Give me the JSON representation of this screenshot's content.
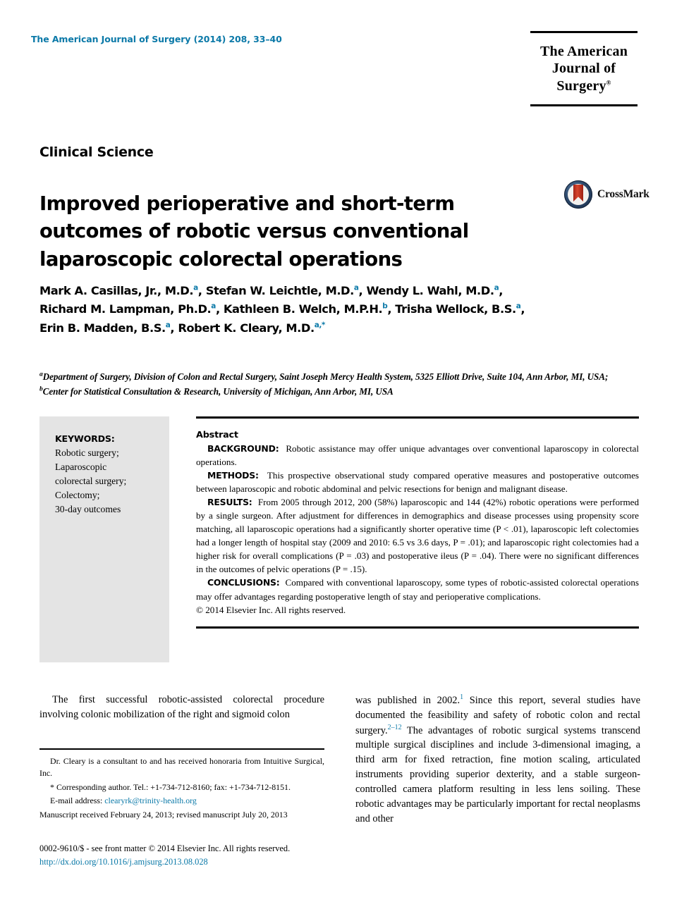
{
  "header": {
    "running_head": "The American Journal of Surgery (2014) 208, 33–40",
    "journal_logo_line1": "The American",
    "journal_logo_line2": "Journal of Surgery",
    "journal_logo_mark": "®"
  },
  "section_label": "Clinical Science",
  "title": "Improved perioperative and short-term outcomes of robotic versus conventional laparoscopic colorectal operations",
  "crossmark": {
    "label": "CrossMark",
    "badge_outer_color": "#2b4668",
    "badge_ribbon_color": "#c0351f"
  },
  "authors": {
    "line1_a": "Mark A. Casillas, Jr., M.D.",
    "line1_a_sup": "a",
    "line1_b": ", Stefan W. Leichtle, M.D.",
    "line1_b_sup": "a",
    "line1_c": ", Wendy L. Wahl, M.D.",
    "line1_c_sup": "a",
    "line1_d": ",",
    "line2_a": "Richard M. Lampman, Ph.D.",
    "line2_a_sup": "a",
    "line2_b": ", Kathleen B. Welch, M.P.H.",
    "line2_b_sup": "b",
    "line2_c": ", Trisha Wellock, B.S.",
    "line2_c_sup": "a",
    "line2_d": ",",
    "line3_a": "Erin B. Madden, B.S.",
    "line3_a_sup": "a",
    "line3_b": ", Robert K. Cleary, M.D.",
    "line3_b_sup": "a,*",
    "accent_color": "#0b79a8"
  },
  "affiliations": {
    "sup_a": "a",
    "text_a": "Department of Surgery, Division of Colon and Rectal Surgery, Saint Joseph Mercy Health System, 5325 Elliott Drive, Suite 104, Ann Arbor, MI, USA; ",
    "sup_b": "b",
    "text_b": "Center for Statistical Consultation & Research, University of Michigan, Ann Arbor, MI, USA"
  },
  "keywords": {
    "heading": "KEYWORDS:",
    "items": [
      "Robotic surgery;",
      "Laparoscopic",
      "colorectal surgery;",
      "Colectomy;",
      "30-day outcomes"
    ],
    "background_color": "#e4e4e4"
  },
  "abstract": {
    "heading": "Abstract",
    "background_label": "BACKGROUND:",
    "background_text": "Robotic assistance may offer unique advantages over conventional laparoscopy in colorectal operations.",
    "methods_label": "METHODS:",
    "methods_text": "This prospective observational study compared operative measures and postoperative outcomes between laparoscopic and robotic abdominal and pelvic resections for benign and malignant disease.",
    "results_label": "RESULTS:",
    "results_text": "From 2005 through 2012, 200 (58%) laparoscopic and 144 (42%) robotic operations were performed by a single surgeon. After adjustment for differences in demographics and disease processes using propensity score matching, all laparoscopic operations had a significantly shorter operative time (P < .01), laparoscopic left colectomies had a longer length of hospital stay (2009 and 2010: 6.5 vs 3.6 days, P = .01); and laparoscopic right colectomies had a higher risk for overall complications (P = .03) and postoperative ileus (P = .04). There were no significant differences in the outcomes of pelvic operations (P = .15).",
    "conclusions_label": "CONCLUSIONS:",
    "conclusions_text": "Compared with conventional laparoscopy, some types of robotic-assisted colorectal operations may offer advantages regarding postoperative length of stay and perioperative complications.",
    "copyright": "© 2014 Elsevier Inc. All rights reserved."
  },
  "body": {
    "left_para": "The first successful robotic-assisted colorectal procedure involving colonic mobilization of the right and sigmoid colon",
    "right_para_1": "was published in 2002.",
    "right_sup_1": "1",
    "right_para_2": " Since this report, several studies have documented the feasibility and safety of robotic colon and rectal surgery.",
    "right_sup_2": "2–12",
    "right_para_3": " The advantages of robotic surgical systems transcend multiple surgical disciplines and include 3-dimensional imaging, a third arm for fixed retraction, fine motion scaling, articulated instruments providing superior dexterity, and a stable surgeon-controlled camera platform resulting in less lens soiling. These robotic advantages may be particularly important for rectal neoplasms and other"
  },
  "footnotes": {
    "disclosure": "Dr. Cleary is a consultant to and has received honoraria from Intuitive Surgical, Inc.",
    "corresponding_marker": "*",
    "corresponding": "Corresponding author. Tel.: +1-734-712-8160; fax: +1-734-712-8151.",
    "email_label": "E-mail address:",
    "email": "clearyrk@trinity-health.org",
    "manuscript": "Manuscript received February 24, 2013; revised manuscript July 20, 2013"
  },
  "footer": {
    "front_matter": "0002-9610/$ - see front matter © 2014 Elsevier Inc. All rights reserved.",
    "doi": "http://dx.doi.org/10.1016/j.amjsurg.2013.08.028"
  }
}
